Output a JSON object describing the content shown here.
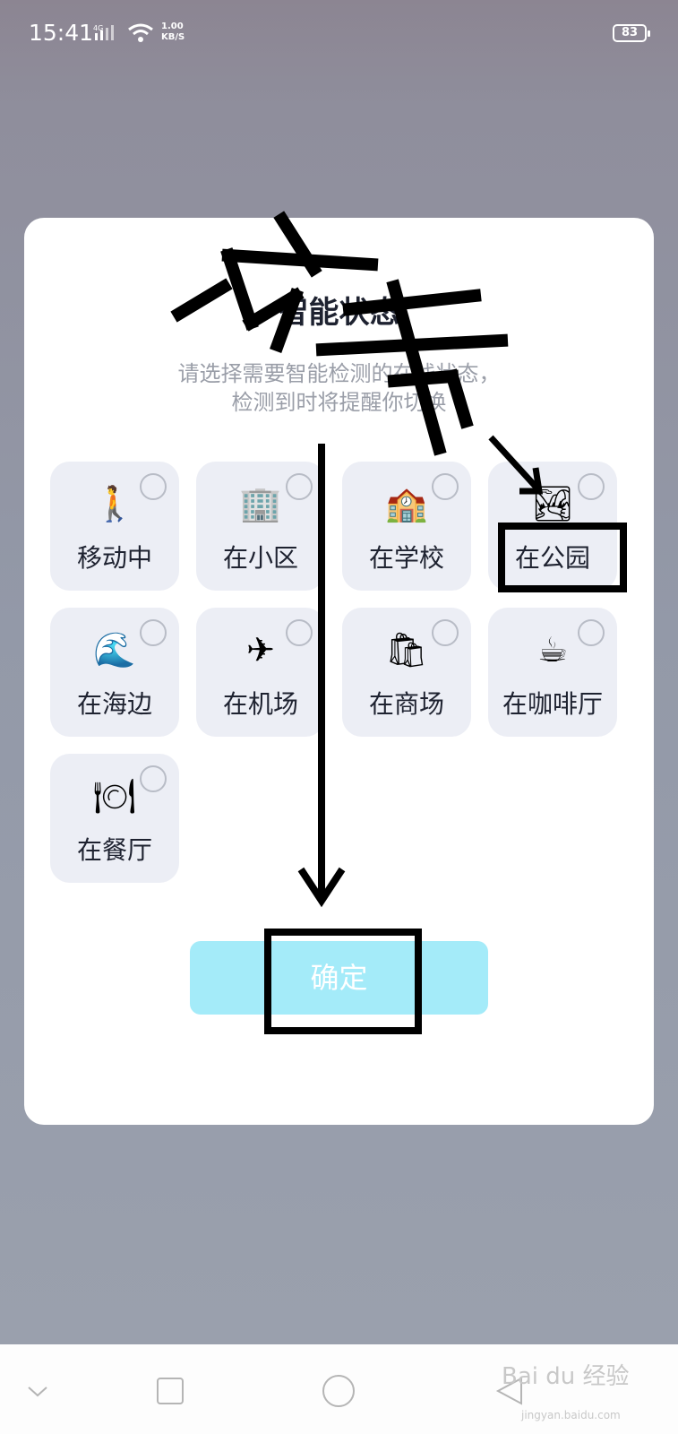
{
  "status_bar": {
    "time": "15:41",
    "signal_label": "4G",
    "speed_value": "1.00",
    "speed_unit": "KB/S",
    "battery": "83",
    "icons": [
      "signal-icon",
      "wifi-icon",
      "battery-icon"
    ]
  },
  "dialog": {
    "title": "智能状态",
    "subtitle_line1": "请选择需要智能检测的在线状态，",
    "subtitle_line2": "检测到时将提醒你切换",
    "options": [
      {
        "label": "移动中",
        "icon": "🚶",
        "icon_name": "walking-icon"
      },
      {
        "label": "在小区",
        "icon": "🏢",
        "icon_name": "building-icon"
      },
      {
        "label": "在学校",
        "icon": "🏫",
        "icon_name": "school-icon"
      },
      {
        "label": "在公园",
        "icon": "🏞",
        "icon_name": "park-bench-icon"
      },
      {
        "label": "在海边",
        "icon": "🌊",
        "icon_name": "wave-icon"
      },
      {
        "label": "在机场",
        "icon": "✈",
        "icon_name": "airport-icon"
      },
      {
        "label": "在商场",
        "icon": "🛍",
        "icon_name": "shopping-bag-icon"
      },
      {
        "label": "在咖啡厅",
        "icon": "☕",
        "icon_name": "coffee-icon"
      },
      {
        "label": "在餐厅",
        "icon": "🍽",
        "icon_name": "plate-icon"
      }
    ],
    "confirm_label": "确定"
  },
  "annotation": {
    "text": "点击"
  },
  "nav_bar": {
    "icons": [
      "back-chevron-icon",
      "recent-apps-icon",
      "home-icon",
      "back-triangle-icon"
    ]
  },
  "watermark": {
    "text": "Bai du 经验",
    "sub": "jingyan.baidu.com"
  },
  "colors": {
    "confirm_button": "#a4ebf9",
    "option_background": "#eceef5",
    "dialog_background": "#ffffff"
  }
}
